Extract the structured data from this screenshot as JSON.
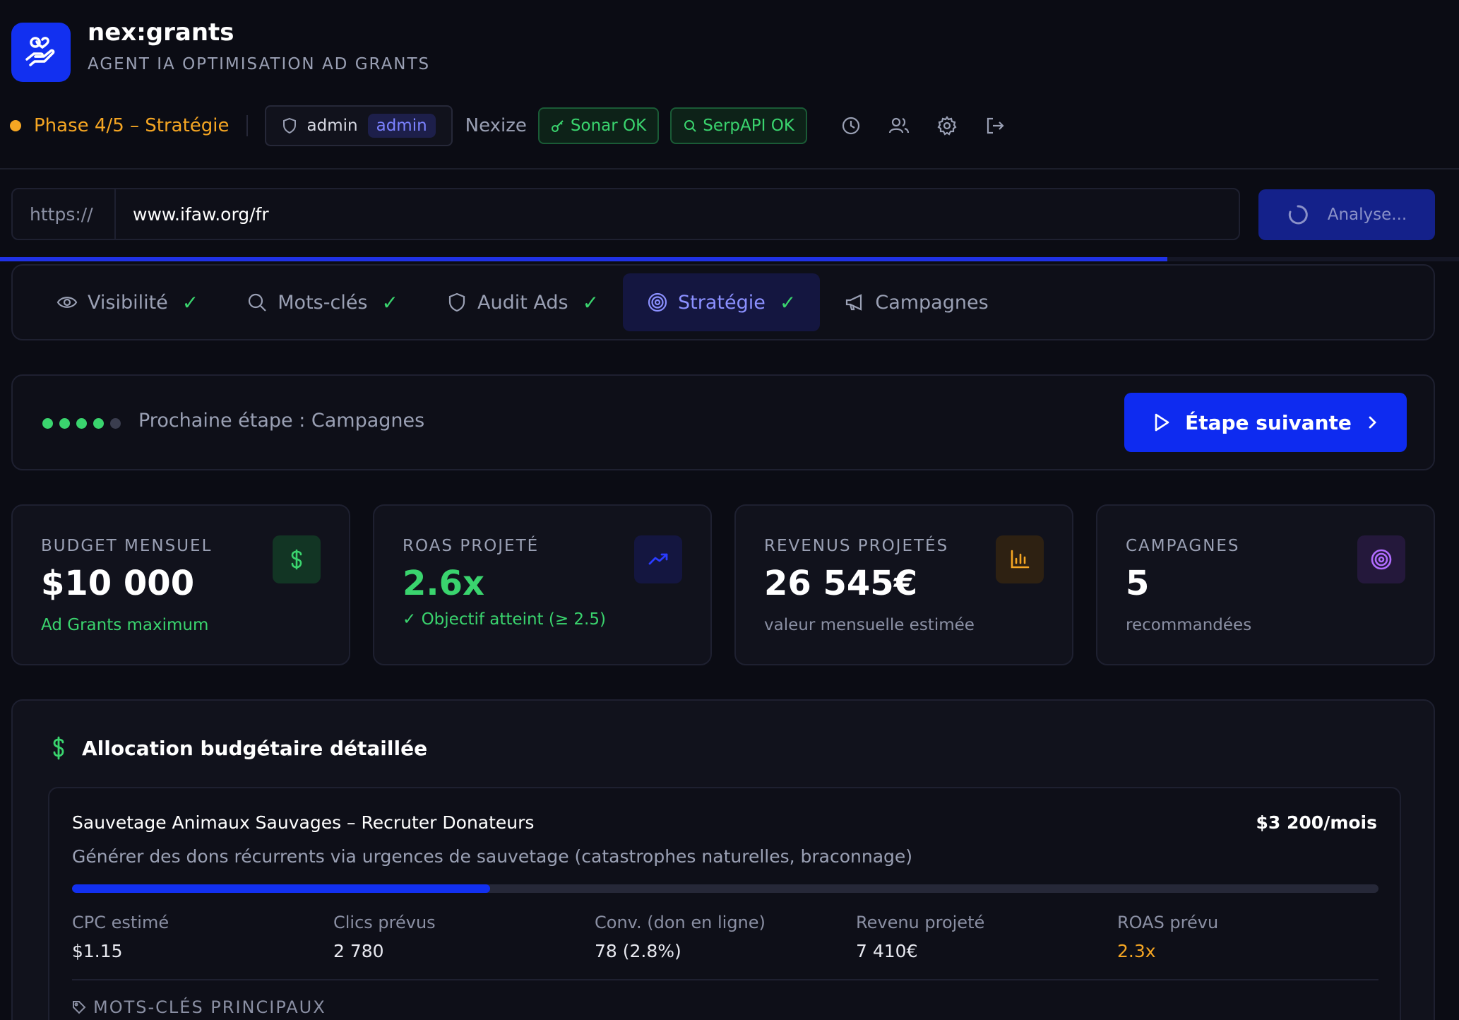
{
  "app": {
    "name": "nex:grants",
    "subtitle": "AGENT IA OPTIMISATION AD GRANTS"
  },
  "toolbar": {
    "phase": "Phase 4/5 – Stratégie",
    "user": "admin",
    "role": "admin",
    "org": "Nexize",
    "status": [
      {
        "label": "Sonar OK",
        "icon": "key-icon"
      },
      {
        "label": "SerpAPI OK",
        "icon": "search-icon"
      }
    ],
    "icons": [
      "history-icon",
      "users-icon",
      "settings-icon",
      "logout-icon"
    ]
  },
  "url": {
    "protocol": "https://",
    "value": "www.ifaw.org/fr",
    "analyse_label": "Analyse...",
    "progress_pct": 80
  },
  "tabs": [
    {
      "label": "Visibilité",
      "icon": "eye-icon",
      "done": true,
      "active": false
    },
    {
      "label": "Mots-clés",
      "icon": "search-icon",
      "done": true,
      "active": false
    },
    {
      "label": "Audit Ads",
      "icon": "shield-icon",
      "done": true,
      "active": false
    },
    {
      "label": "Stratégie",
      "icon": "target-icon",
      "done": true,
      "active": true
    },
    {
      "label": "Campagnes",
      "icon": "megaphone-icon",
      "done": false,
      "active": false
    }
  ],
  "next_step": {
    "completed_steps": 4,
    "total_steps": 5,
    "text": "Prochaine étape : Campagnes",
    "button_label": "Étape suivante"
  },
  "stats": [
    {
      "label": "BUDGET MENSUEL",
      "value": "$10 000",
      "sub": "Ad Grants maximum",
      "value_color": "#ffffff",
      "sub_color": "#3ad46e",
      "icon": "dollar-icon",
      "icon_color": "#3ad46e",
      "icon_bg": "#123524"
    },
    {
      "label": "ROAS PROJETÉ",
      "value": "2.6x",
      "sub": "✓ Objectif atteint (≥ 2.5)",
      "value_color": "#3ad46e",
      "sub_color": "#3ad46e",
      "icon": "trend-up-icon",
      "icon_color": "#2a3cff",
      "icon_bg": "#141640"
    },
    {
      "label": "REVENUS PROJETÉS",
      "value": "26 545€",
      "sub": "valeur mensuelle estimée",
      "value_color": "#ffffff",
      "sub_color": "#8a8fa3",
      "icon": "bar-chart-icon",
      "icon_color": "#f5a623",
      "icon_bg": "#2e2112"
    },
    {
      "label": "CAMPAGNES",
      "value": "5",
      "sub": "recommandées",
      "value_color": "#ffffff",
      "sub_color": "#8a8fa3",
      "icon": "target-icon",
      "icon_color": "#b06cff",
      "icon_bg": "#24183b"
    }
  ],
  "allocation": {
    "title": "Allocation budgétaire détaillée",
    "campaign": {
      "name": "Sauvetage Animaux Sauvages – Recruter Donateurs",
      "price": "$3 200/mois",
      "description": "Générer des dons récurrents via urgences de sauvetage (catastrophes naturelles, braconnage)",
      "budget_share_pct": 32,
      "metrics": [
        {
          "label": "CPC estimé",
          "value": "$1.15"
        },
        {
          "label": "Clics prévus",
          "value": "2 780"
        },
        {
          "label": "Conv. (don en ligne)",
          "value": "78 (2.8%)"
        },
        {
          "label": "Revenu projeté",
          "value": "7 410€"
        },
        {
          "label": "ROAS prévu",
          "value": "2.3x",
          "accent": true
        }
      ],
      "keywords_label": "MOTS-CLÉS PRINCIPAUX"
    }
  }
}
